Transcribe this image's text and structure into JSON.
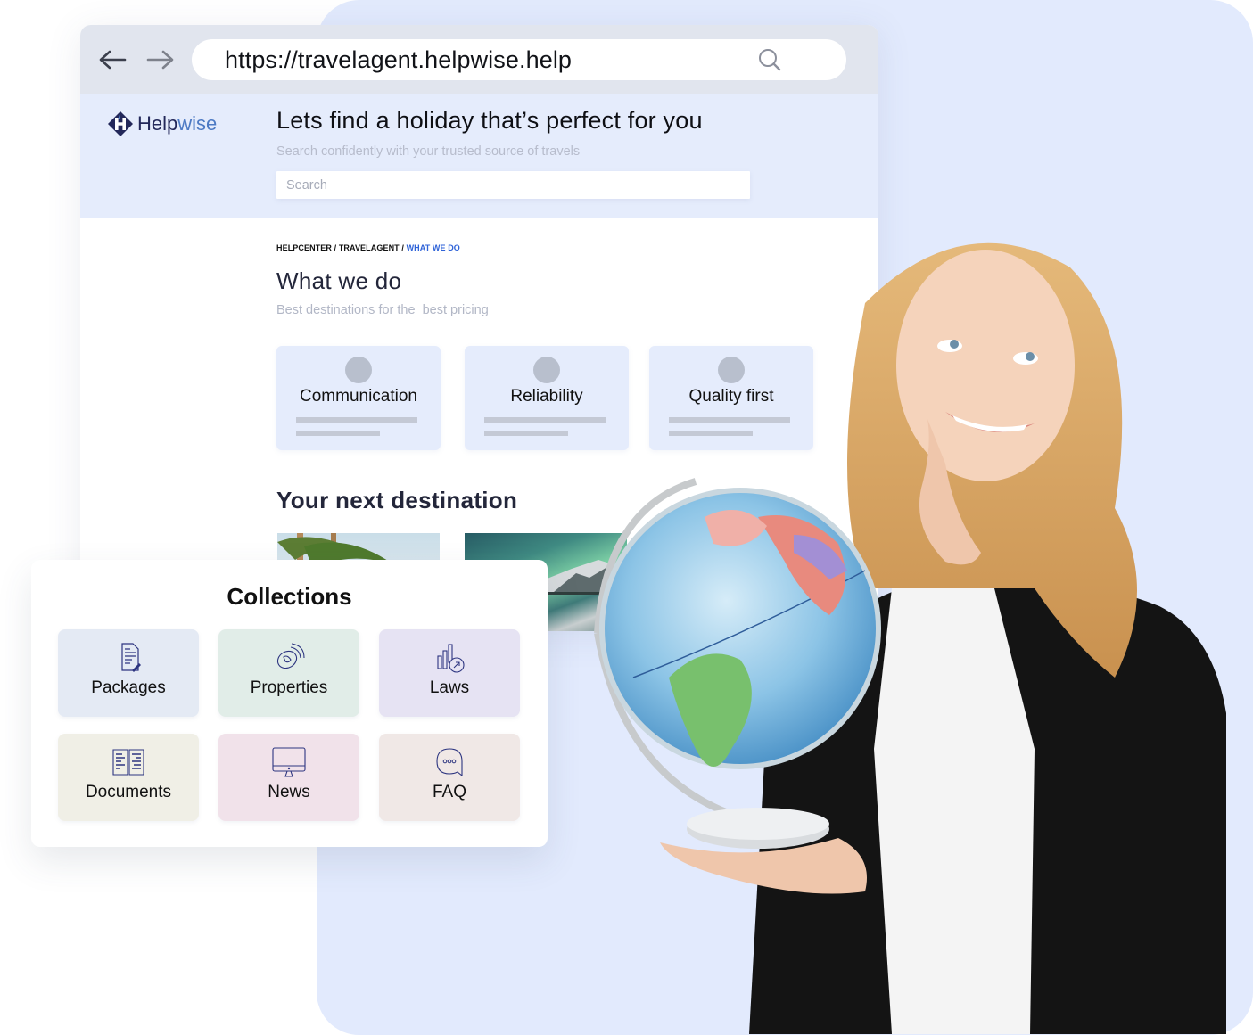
{
  "browser": {
    "url": "https://travelagent.helpwise.help",
    "back_icon": "arrow-left-icon",
    "forward_icon": "arrow-right-icon",
    "search_icon": "search-icon"
  },
  "brand": {
    "name_part1": "Help",
    "name_part2": "wise",
    "logo_icon": "helpwise-logo-icon",
    "primary_color": "#23285a",
    "accent_color": "#4d7ac4"
  },
  "hero": {
    "title": "Lets find a holiday that’s perfect for you",
    "subtitle": "Search confidently with your trusted source of travels",
    "search_placeholder": "Search",
    "search_value": ""
  },
  "breadcrumb": {
    "items": [
      "HELPCENTER",
      "TRAVELAGENT",
      "WHAT WE DO"
    ],
    "separator": " / ",
    "active_color": "#2f63d8"
  },
  "section": {
    "title": "What we do",
    "subtitle": "Best destinations for the  best pricing"
  },
  "features": [
    {
      "label": "Communication"
    },
    {
      "label": "Reliability"
    },
    {
      "label": "Quality first"
    }
  ],
  "destinations": {
    "title": "Your next destination",
    "items": [
      {
        "name": "tropical-palms-photo"
      },
      {
        "name": "northern-lights-photo"
      },
      {
        "name": "forest-photo"
      }
    ]
  },
  "collections": {
    "title": "Collections",
    "items": [
      {
        "label": "Packages",
        "icon": "document-edit-icon",
        "color": "#e4eaf4"
      },
      {
        "label": "Properties",
        "icon": "phone-call-icon",
        "color": "#e1ede8"
      },
      {
        "label": "Laws",
        "icon": "bar-chart-icon",
        "color": "#e6e3f3"
      },
      {
        "label": "Documents",
        "icon": "open-book-icon",
        "color": "#f0efe6"
      },
      {
        "label": "News",
        "icon": "monitor-icon",
        "color": "#f1e2ea"
      },
      {
        "label": "FAQ",
        "icon": "chat-bubble-icon",
        "color": "#f0e8e6"
      }
    ]
  },
  "illustration": {
    "subject": "woman-holding-globe-photo",
    "backdrop_color": "#e2eafd"
  }
}
